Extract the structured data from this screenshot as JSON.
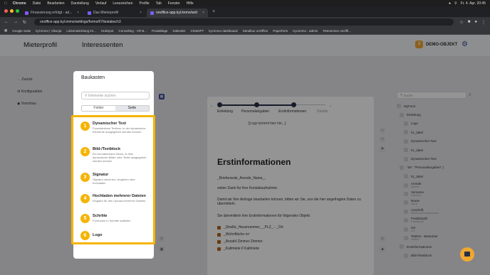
{
  "menubar": {
    "apple": "",
    "app": "Chrome",
    "items": [
      "Datei",
      "Bearbeiten",
      "Darstellung",
      "Verlauf",
      "Lesezeichen",
      "Profile",
      "Tab",
      "Fenster",
      "Hilfe"
    ],
    "clock": "Fr. 4. Apr. 20:45"
  },
  "tabs": [
    {
      "label": "Finanzierung erfolgt - ad...",
      "active": false
    },
    {
      "label": "Das Mieterprofil",
      "active": false
    },
    {
      "label": "onoffice-app.kyl.immo/sett",
      "active": true
    }
  ],
  "address": {
    "url": "onoffice-app.kyl.immo/settings/forms/67/testabsch3"
  },
  "bookmarks": [
    "Google Suite",
    "kyl.immo | Vikunja",
    "Linkentwicklung im...",
    "HubSpot",
    "Consulting - VR B...",
    "Postablage",
    "Kalender",
    "ChatGPT",
    "kyl.immo dashboard",
    "Sandbox onOffice",
    "Paperform",
    "KyLimmo - admin",
    "Testversion onOffi..."
  ],
  "header": {
    "title1": "Mieterprofil",
    "title2": "Interessenten",
    "object_num": "3",
    "object_label": "DEMO-OBJEKT"
  },
  "leftnav": {
    "back": "Zurück",
    "config": "Konfiguration",
    "preview": "Vorschau"
  },
  "canvas": {
    "steps": [
      "Einleitung",
      "Personalangaben",
      "Erstinformationen",
      "Details"
    ],
    "logo": "[Logo kommt hier hin...]",
    "heading": "Erstinformationen",
    "salutation": "_Briefanrede_Anrede_Name_,",
    "p1": "vielen Dank für Ihre Kontaktaufnahme.",
    "p2": "Damit wir Ihre Anfrage bearbeiten können, bitten wir Sie, uns die hier angefragten Daten zu übermitteln.",
    "p3": "Sie übermitteln ihre Erstinformationen für folgendes Objekt:",
    "r1": "_Straße_Hausnummer_ _PLZ_ - _Ort",
    "r2": "_Wohnfläche m²",
    "r3": "_Anzahl Zimmer Zimmer",
    "r4": "_Kaltmiete € Kaltmiete"
  },
  "right": {
    "search": "Suche",
    "tree": [
      {
        "label": "MyForm",
        "sub": ""
      },
      {
        "label": "Einleitung",
        "sub": ""
      },
      {
        "label": "Logo",
        "sub": ""
      },
      {
        "label": "h1_label",
        "sub": ""
      },
      {
        "label": "Dynamischer Text",
        "sub": ""
      },
      {
        "label": "h1_label",
        "sub": ""
      },
      {
        "label": "Dynamischer Text",
        "sub": ""
      },
      {
        "label": "\"de\": \"Personalangaben\" }",
        "sub": ""
      },
      {
        "label": "h1_label",
        "sub": ""
      },
      {
        "label": "Anrede",
        "sub": "Anrede"
      },
      {
        "label": "Vorname",
        "sub": "Vorname"
      },
      {
        "label": "Name",
        "sub": "Name"
      },
      {
        "label": "Anschrift",
        "sub": "Straße und Hausnummer"
      },
      {
        "label": "Postleitzahl",
        "sub": "Postleitzahl"
      },
      {
        "label": "Ort",
        "sub": "Ort"
      },
      {
        "label": "Telefon - Bewerber",
        "sub": "Telefon"
      },
      {
        "label": "Erstinformationen",
        "sub": ""
      },
      {
        "label": "Bild-/Textblock",
        "sub": ""
      }
    ]
  },
  "baukasten": {
    "title": "Baukasten",
    "search_placeholder": "Elemente suchen",
    "toggle": [
      "Felder",
      "Seite"
    ],
    "items": [
      {
        "num": "1",
        "name": "Dynamischer Text",
        "desc": "Formatierbare Textbox, in der dynamische Elemente ausgegeben werden können"
      },
      {
        "num": "2",
        "name": "Bild-/Textblock",
        "desc": "Ein formatierbarer Block, in dem dynamische Bilder oder Texte ausgegeben werden können"
      },
      {
        "num": "3",
        "name": "Signatur",
        "desc": "Signatur zeichnen, eingeben oder hochladen"
      },
      {
        "num": "4",
        "name": "Hochladen mehrerer Dateien",
        "desc": "Eingabe für den Upload mehrerer Dateien"
      },
      {
        "num": "5",
        "name": "Schritte",
        "desc": "Formulare in Schritte aufteilen"
      },
      {
        "num": "6",
        "name": "Logo",
        "desc": ""
      }
    ]
  }
}
